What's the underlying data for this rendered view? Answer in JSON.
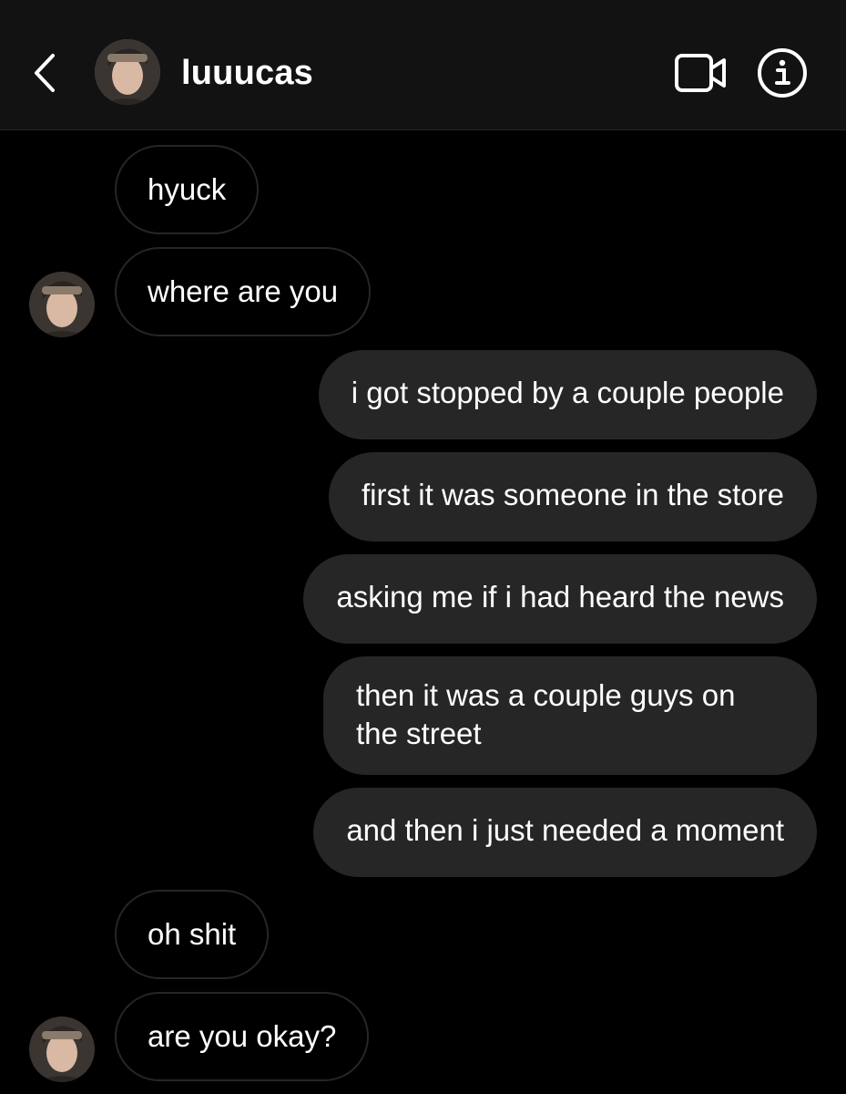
{
  "header": {
    "username": "luuucas",
    "back_icon": "chevron-left-icon",
    "video_icon": "video-camera-icon",
    "info_icon": "info-icon"
  },
  "messages": [
    {
      "sender": "them",
      "text": "hyuck"
    },
    {
      "sender": "them",
      "text": "where are you"
    },
    {
      "sender": "me",
      "text": "i got stopped by a couple people"
    },
    {
      "sender": "me",
      "text": "first it was someone in the store"
    },
    {
      "sender": "me",
      "text": "asking me if i had heard the news"
    },
    {
      "sender": "me",
      "text": "then it was a couple guys on the street"
    },
    {
      "sender": "me",
      "text": "and then i just needed a moment"
    },
    {
      "sender": "them",
      "text": "oh shit"
    },
    {
      "sender": "them",
      "text": "are you okay?"
    }
  ],
  "colors": {
    "background": "#000000",
    "header_background": "#121212",
    "outgoing_bubble": "#262626",
    "incoming_border": "#262626",
    "text": "#ffffff"
  }
}
